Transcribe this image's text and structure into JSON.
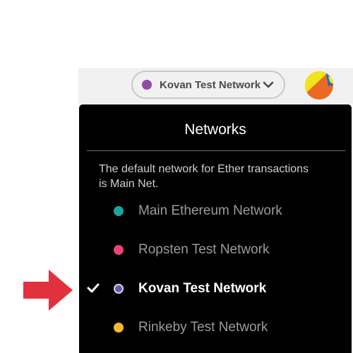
{
  "header": {
    "network_selector": {
      "label": "Kovan Test Network",
      "dot_color": "#8e4ba8",
      "icon": "chevron-down-icon"
    },
    "account_avatar": {
      "colors": [
        "#f2e41b",
        "#ea6a23",
        "#1b6fc2"
      ]
    }
  },
  "dropdown": {
    "title": "Networks",
    "description": "The default network for Ether transactions is Main Net.",
    "networks": [
      {
        "label": "Main Ethereum Network",
        "color": "#1aa6a0",
        "selected": false
      },
      {
        "label": "Ropsten Test Network",
        "color": "#e94377",
        "selected": false
      },
      {
        "label": "Kovan Test Network",
        "color": "#6a57b5",
        "selected": true
      },
      {
        "label": "Rinkeby Test Network",
        "color": "#f5b82e",
        "selected": false
      }
    ]
  },
  "annotation": {
    "icon": "red-arrow-icon",
    "color": "#e2313e"
  }
}
